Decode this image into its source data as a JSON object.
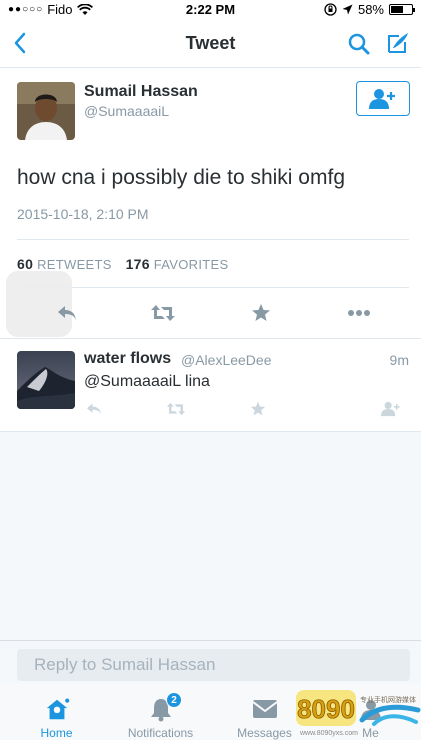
{
  "status_bar": {
    "signal": "●●○○○",
    "carrier": "Fido",
    "time": "2:22 PM",
    "battery": "58%",
    "battery_level": 0.58
  },
  "nav": {
    "title": "Tweet",
    "icons": [
      "back-chevron-icon",
      "search-icon",
      "compose-icon"
    ]
  },
  "tweet": {
    "author_name": "Sumail Hassan",
    "author_handle": "@SumaaaaiL",
    "text": "how cna i possibly die to shiki omfg",
    "date": "2015-10-18, 2:10 PM",
    "retweets_count": "60",
    "retweets_label": "RETWEETS",
    "favorites_count": "176",
    "favorites_label": "FAVORITES"
  },
  "reply": {
    "author_name": "water flows",
    "author_handle": "@AlexLeeDee",
    "time": "9m",
    "text": "@SumaaaaiL lina"
  },
  "compose": {
    "placeholder": "Reply to Sumail Hassan"
  },
  "tabs": [
    {
      "label": "Home",
      "active": true
    },
    {
      "label": "Notifications",
      "badge": "2"
    },
    {
      "label": "Messages"
    },
    {
      "label": "Me"
    }
  ],
  "watermark": {
    "brand": "8090",
    "tagline": "专业手机网游媒体",
    "url": "www.8090yxs.com"
  },
  "colors": {
    "accent": "#1b95e0",
    "muted": "#8899a6",
    "text": "#292f33",
    "divider": "#e1e8ed",
    "background_light": "#f5f8fa"
  }
}
